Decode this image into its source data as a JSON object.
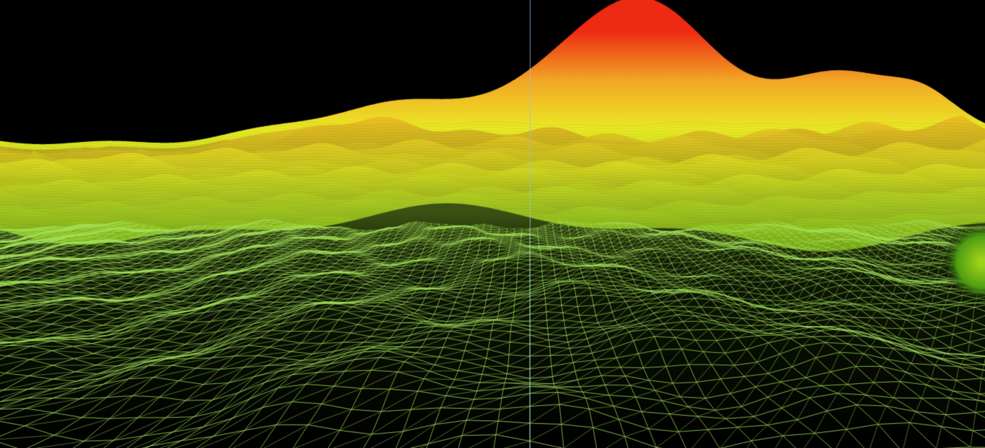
{
  "scene": {
    "type": "3d-terrain-mesh",
    "render_mode": "wireframe-to-shaded",
    "background_color": "#000000",
    "wireframe_color": "#a6e35a",
    "color_ramp": {
      "low": "#4f9e12",
      "mid_low": "#9fd21c",
      "mid": "#eaea24",
      "mid_high": "#f2a626",
      "high": "#ee2a12"
    },
    "features": [
      "foreground-wireframe-grid",
      "rolling-hills",
      "central-peak",
      "right-ridge"
    ],
    "guide_line_color": "#96beeb"
  }
}
